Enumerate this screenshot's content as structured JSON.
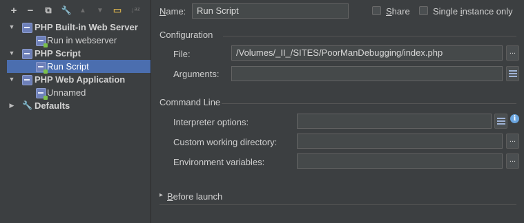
{
  "toolbar": {
    "add": "+",
    "remove": "−",
    "copy": "⧉",
    "edit_defaults": "🔧",
    "move_up": "▲",
    "move_down": "▼",
    "folder": "▭",
    "sort": "↓ᵃᶻ"
  },
  "tree": {
    "items": [
      {
        "label": "PHP Built-in Web Server",
        "icon": "php-icon",
        "expanded": true
      },
      {
        "label": "Run in webserver",
        "icon": "php-run-icon"
      },
      {
        "label": "PHP Script",
        "icon": "php-icon",
        "expanded": true
      },
      {
        "label": "Run Script",
        "icon": "php-run-icon",
        "selected": true
      },
      {
        "label": "PHP Web Application",
        "icon": "php-icon",
        "expanded": true
      },
      {
        "label": "Unnamed",
        "icon": "php-run-icon"
      },
      {
        "label": "Defaults",
        "icon": "wrench-icon",
        "expanded": false
      }
    ]
  },
  "header": {
    "name_label_n": "N",
    "name_label_rest": "ame:",
    "name_value": "Run Script",
    "share_label_pre": "",
    "share_label_u": "S",
    "share_label_rest": "hare",
    "single_label_pre": "Single ",
    "single_label_u": "i",
    "single_label_rest": "nstance only"
  },
  "configuration": {
    "title": "Configuration",
    "file_label": "File:",
    "file_value": "/Volumes/_II_/SITES/PoorManDebugging/index.php",
    "arguments_label": "Arguments:",
    "arguments_value": ""
  },
  "command_line": {
    "title": "Command Line",
    "interpreter_label": "Interpreter options:",
    "interpreter_value": "",
    "workdir_label": "Custom working directory:",
    "workdir_value": "",
    "env_label": "Environment variables:",
    "env_value": ""
  },
  "before_launch": {
    "arrow": "▸",
    "label_u": "B",
    "label_rest": "efore launch"
  },
  "buttons": {
    "browse": "..."
  },
  "colors": {
    "selection": "#4b6eaf",
    "panel": "#3c3f41",
    "field": "#45494a"
  }
}
